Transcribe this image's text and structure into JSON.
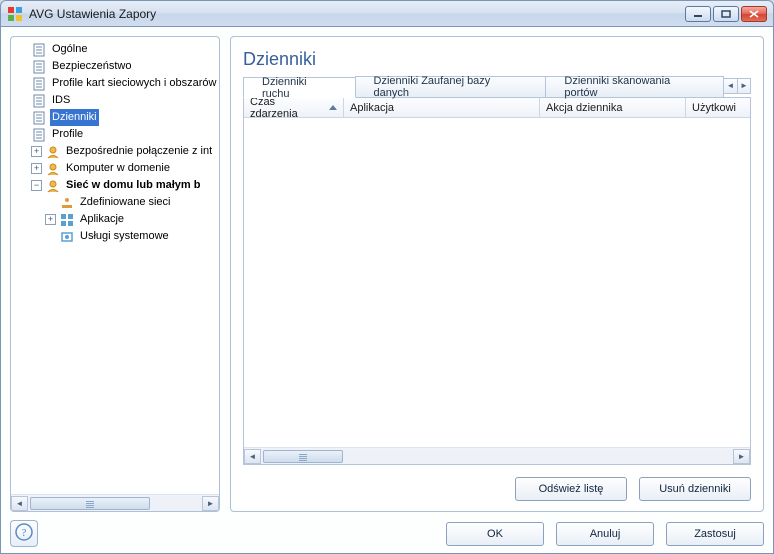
{
  "window": {
    "title": "AVG Ustawienia Zapory"
  },
  "tree": {
    "items": {
      "ogolne": "Ogólne",
      "bezpieczenstwo": "Bezpieczeństwo",
      "profile_kart": "Profile kart sieciowych i obszarów",
      "ids": "IDS",
      "dzienniki": "Dzienniki",
      "profile": "Profile",
      "bezposrednie": "Bezpośrednie połączenie z int",
      "komputer_domena": "Komputer w domenie",
      "siec_domu": "Sieć w domu lub małym b",
      "zdef_sieci": "Zdefiniowane sieci",
      "aplikacje": "Aplikacje",
      "uslugi": "Usługi systemowe"
    }
  },
  "content": {
    "heading": "Dzienniki",
    "tabs": {
      "ruch": "Dzienniki ruchu",
      "zaufane": "Dzienniki Zaufanej bazy danych",
      "porty": "Dzienniki skanowania portów"
    },
    "columns": {
      "czas": "Czas zdarzenia",
      "aplikacja": "Aplikacja",
      "akcja": "Akcja dziennika",
      "uzytkownik": "Użytkowi"
    },
    "buttons": {
      "odswiez": "Odśwież listę",
      "usun": "Usuń dzienniki"
    }
  },
  "footer": {
    "ok": "OK",
    "anuluj": "Anuluj",
    "zastosuj": "Zastosuj"
  }
}
